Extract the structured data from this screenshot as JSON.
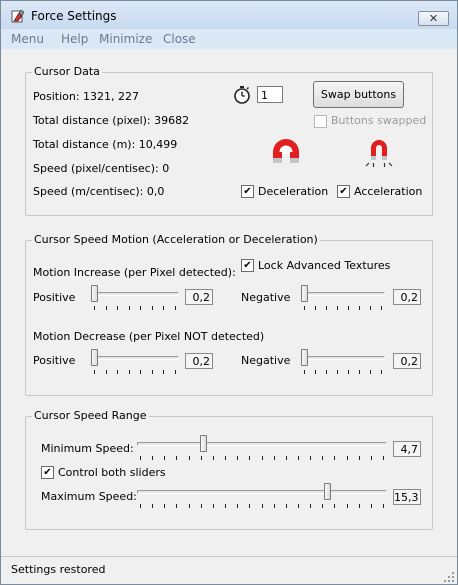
{
  "window": {
    "title": "Force Settings",
    "close_label": "✕"
  },
  "menu": [
    "Menu",
    "Help",
    "Minimize",
    "Close"
  ],
  "cursor_data": {
    "legend": "Cursor Data",
    "position": "Position: 1321, 227",
    "total_pixel": "Total distance (pixel): 39682",
    "total_m": "Total distance (m): 10,499",
    "speed_pixel": "Speed (pixel/centisec): 0",
    "speed_m": "Speed (m/centisec): 0,0",
    "timer_value": "1",
    "swap_label": "Swap buttons",
    "buttons_swapped": {
      "label": "Buttons swapped",
      "checked": false
    },
    "deceleration": {
      "label": "Deceleration",
      "checked": true
    },
    "acceleration": {
      "label": "Acceleration",
      "checked": true
    }
  },
  "motion": {
    "legend": "Cursor Speed Motion (Acceleration or Deceleration)",
    "lock": {
      "label": "Lock Advanced Textures",
      "checked": true
    },
    "increase_label": "Motion Increase (per Pixel detected):",
    "decrease_label": "Motion Decrease (per Pixel NOT detected)",
    "positive_label": "Positive",
    "negative_label": "Negative",
    "inc_positive": "0,2",
    "inc_negative": "0,2",
    "dec_positive": "0,2",
    "dec_negative": "0,2"
  },
  "range": {
    "legend": "Cursor Speed Range",
    "min_label": "Minimum Speed:",
    "min_value": "4,7",
    "control_both": {
      "label": "Control both sliders",
      "checked": true
    },
    "max_label": "Maximum Speed:",
    "max_value": "15,3"
  },
  "status": "Settings restored"
}
